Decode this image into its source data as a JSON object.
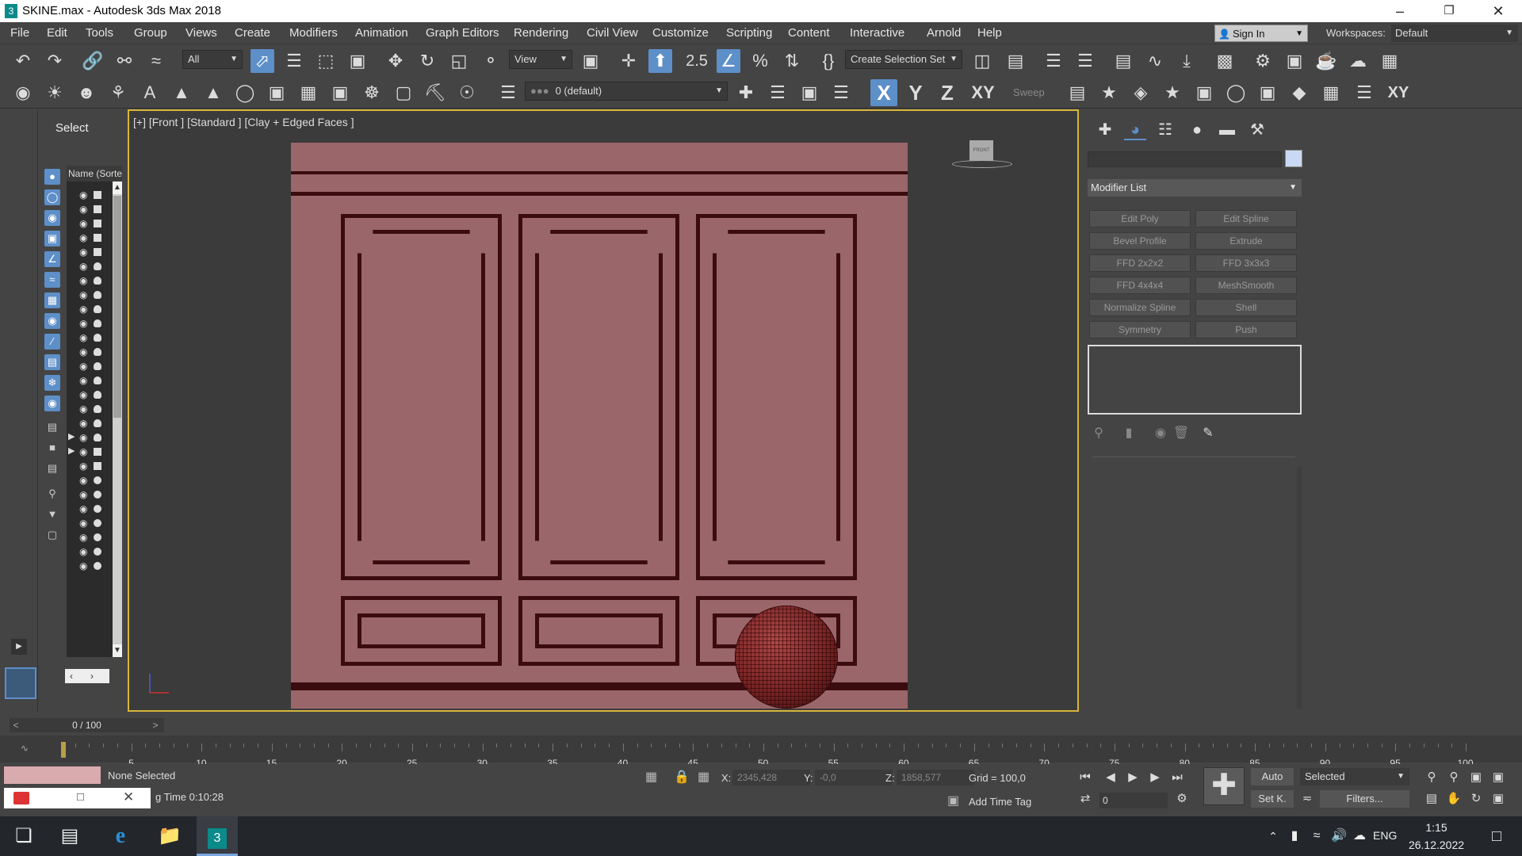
{
  "window": {
    "title": "SKINE.max - Autodesk 3ds Max 2018",
    "app_icon": "3"
  },
  "menu": [
    "File",
    "Edit",
    "Tools",
    "Group",
    "Views",
    "Create",
    "Modifiers",
    "Animation",
    "Graph Editors",
    "Rendering",
    "Civil View",
    "Customize",
    "Scripting",
    "Content",
    "Interactive",
    "Arnold",
    "Help"
  ],
  "account": {
    "sign_in": "Sign In",
    "workspaces_label": "Workspaces:",
    "workspace": "Default"
  },
  "toolbar": {
    "filter": "All",
    "refcoord": "View",
    "snap_angle": "2.5",
    "selection_set": "Create Selection Set",
    "layer": "0 (default)",
    "axis_x": "X",
    "axis_y": "Y",
    "axis_z": "Z",
    "axis_xy": "XY",
    "axis_xy2": "XY",
    "sweep": "Sweep"
  },
  "scene_explorer": {
    "title": "Select",
    "column": "Name (Sorted Ascending)"
  },
  "viewport": {
    "label": "[+] [Front ] [Standard ] [Clay + Edged Faces ]",
    "viewcube": "FRONT"
  },
  "command_panel": {
    "modifier_list": "Modifier List",
    "modifiers": [
      "Edit Poly",
      "Edit Spline",
      "Bevel Profile",
      "Extrude",
      "FFD 2x2x2",
      "FFD 3x3x3",
      "FFD 4x4x4",
      "MeshSmooth",
      "Normalize Spline",
      "Shell",
      "Symmetry",
      "Push"
    ]
  },
  "timeline": {
    "slider": "0 / 100",
    "prev": "<",
    "next": ">",
    "ticks": [
      "5",
      "10",
      "15",
      "20",
      "25",
      "30",
      "35",
      "40",
      "45",
      "50",
      "55",
      "60",
      "65",
      "70",
      "75",
      "80",
      "85",
      "90",
      "95",
      "100"
    ]
  },
  "status": {
    "selection": "None Selected",
    "render_time": "g Time  0:10:28",
    "x_label": "X:",
    "x": "2345,428",
    "y_label": "Y:",
    "y": "-0,0",
    "z_label": "Z:",
    "z": "1858,577",
    "grid": "Grid = 100,0",
    "add_time_tag": "Add Time Tag",
    "frame": "0",
    "auto": "Auto",
    "set_key": "Set K.",
    "key_mode": "Selected",
    "filters": "Filters..."
  },
  "taskbar": {
    "lang": "ENG",
    "time": "1:15",
    "date": "26.12.2022"
  }
}
